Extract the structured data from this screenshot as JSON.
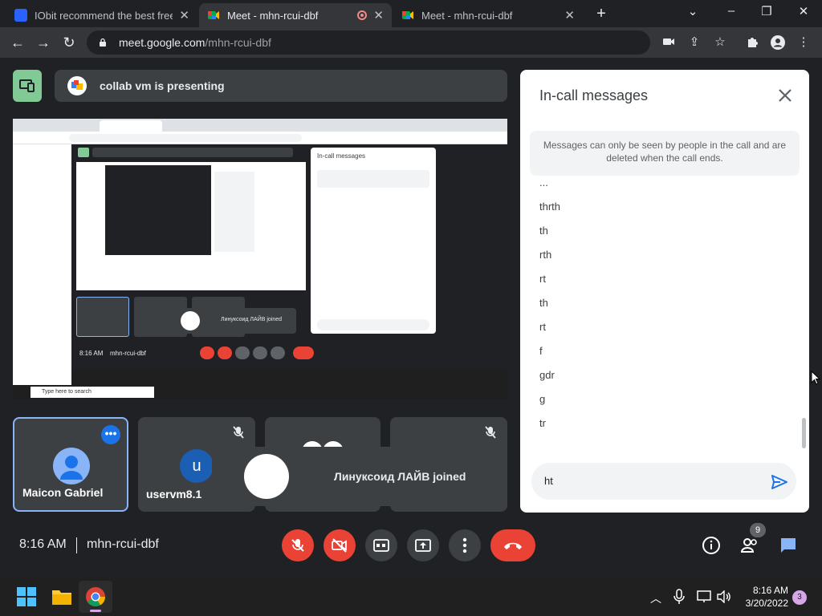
{
  "browser": {
    "tabs": [
      {
        "title": "IObit recommend the best free, f",
        "favicon_color": "#2962ff",
        "active": false
      },
      {
        "title": "Meet - mhn-rcui-dbf",
        "favicon_color": "#00ac47",
        "active": true,
        "recording": true
      },
      {
        "title": "Meet - mhn-rcui-dbf",
        "favicon_color": "#00ac47",
        "active": false
      }
    ],
    "new_tab": "+",
    "url_host": "meet.google.com",
    "url_path": "/mhn-rcui-dbf"
  },
  "meet": {
    "presenting_text": "collab vm is presenting",
    "shared_screen": {
      "search_placeholder": "Type here to search",
      "inner_time": "8:16 AM",
      "inner_code": "mhn-rcui-dbf",
      "inner_joined": "Линуксоид ЛАЙВ joined",
      "inner_chat_title": "In-call messages"
    },
    "participants": [
      {
        "name": "Maicon Gabriel",
        "selected": true
      },
      {
        "name": "uservm8.1",
        "initial": "u",
        "muted": true
      },
      {
        "name": "",
        "muted": false
      },
      {
        "name": "",
        "muted": true
      }
    ],
    "toast": "Линуксоид ЛАЙВ joined",
    "time": "8:16 AM",
    "meeting_code": "mhn-rcui-dbf",
    "people_count": "9"
  },
  "chat": {
    "title": "In-call messages",
    "notice": "Messages can only be seen by people in the call and are deleted when the call ends.",
    "messages": [
      "...",
      "thrth",
      "th",
      "rth",
      "rt",
      "th",
      "rt",
      "f",
      "gdr",
      "g",
      "tr"
    ],
    "input_value": "ht"
  },
  "taskbar": {
    "time": "8:16 AM",
    "date": "3/20/2022",
    "notifications": "3"
  },
  "colors": {
    "accent": "#1a73e8",
    "danger": "#ea4335",
    "presenting_green": "#81c995"
  }
}
